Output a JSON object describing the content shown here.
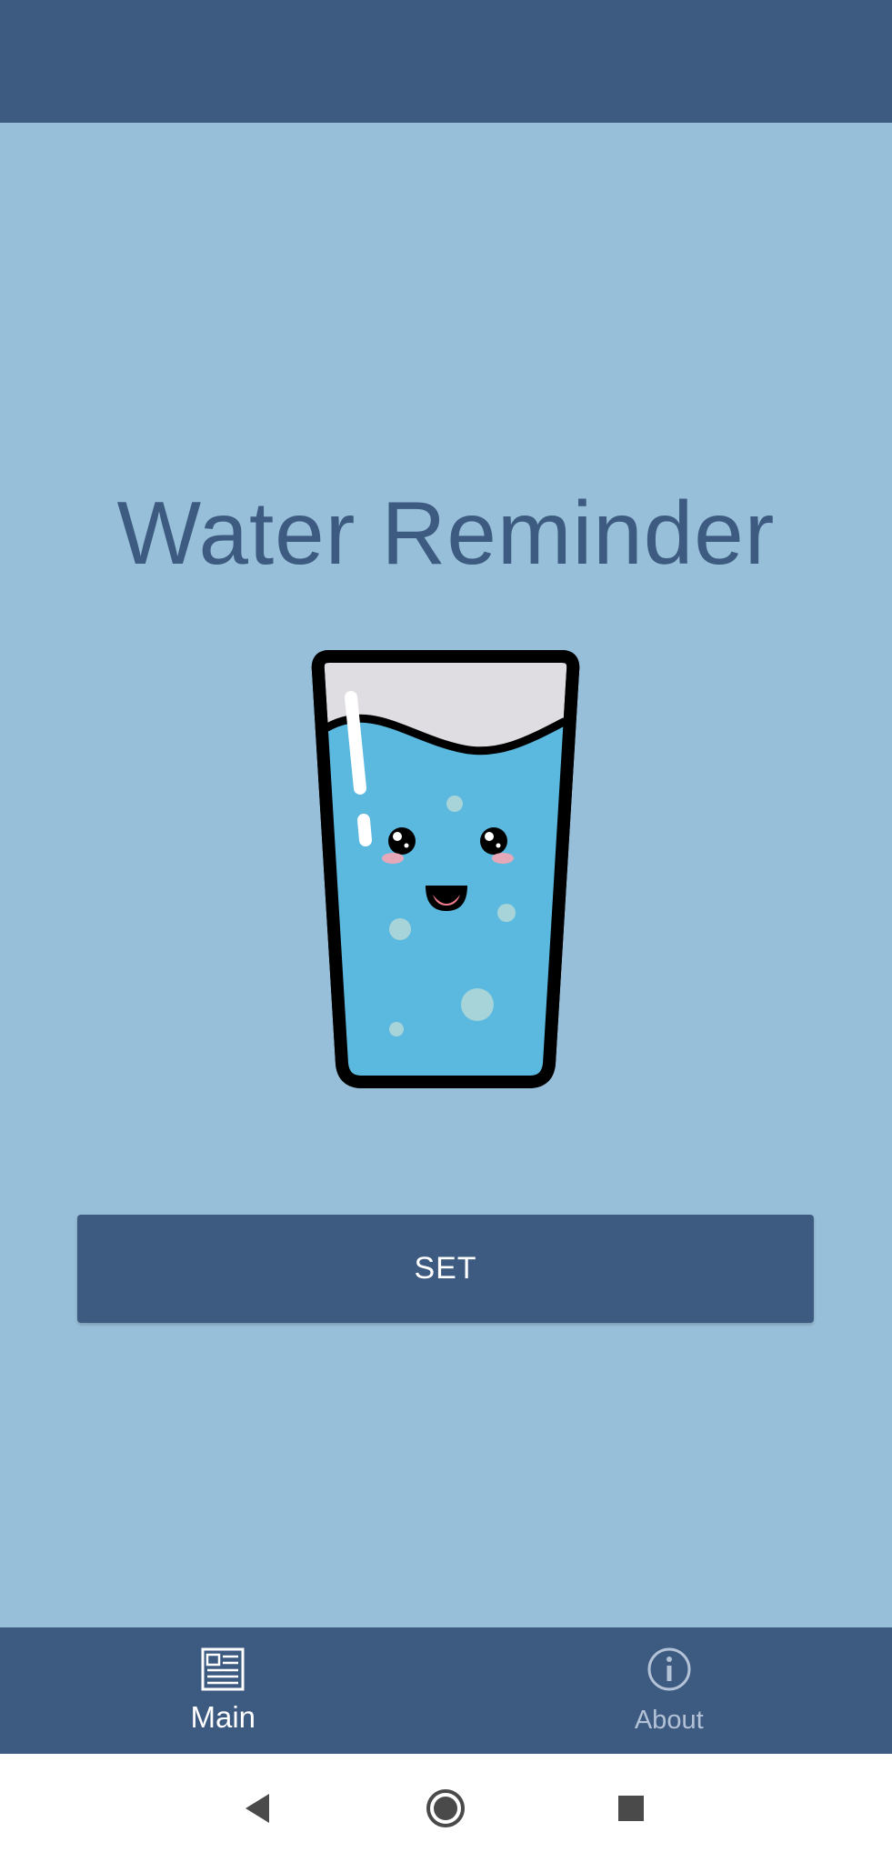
{
  "app": {
    "title": "Water Reminder",
    "illustration": "cute-water-glass-icon"
  },
  "actions": {
    "set_label": "SET"
  },
  "bottom_nav": {
    "items": [
      {
        "label": "Main",
        "icon": "newspaper-icon",
        "active": true
      },
      {
        "label": "About",
        "icon": "info-icon",
        "active": false
      }
    ]
  },
  "system_nav": {
    "buttons": [
      "back-icon",
      "home-icon",
      "recents-icon"
    ]
  },
  "colors": {
    "primary": "#3d5a80",
    "background": "#98bfd9",
    "water": "#5bb9df",
    "on_primary": "#ffffff",
    "inactive_nav": "#b3c2d6"
  }
}
